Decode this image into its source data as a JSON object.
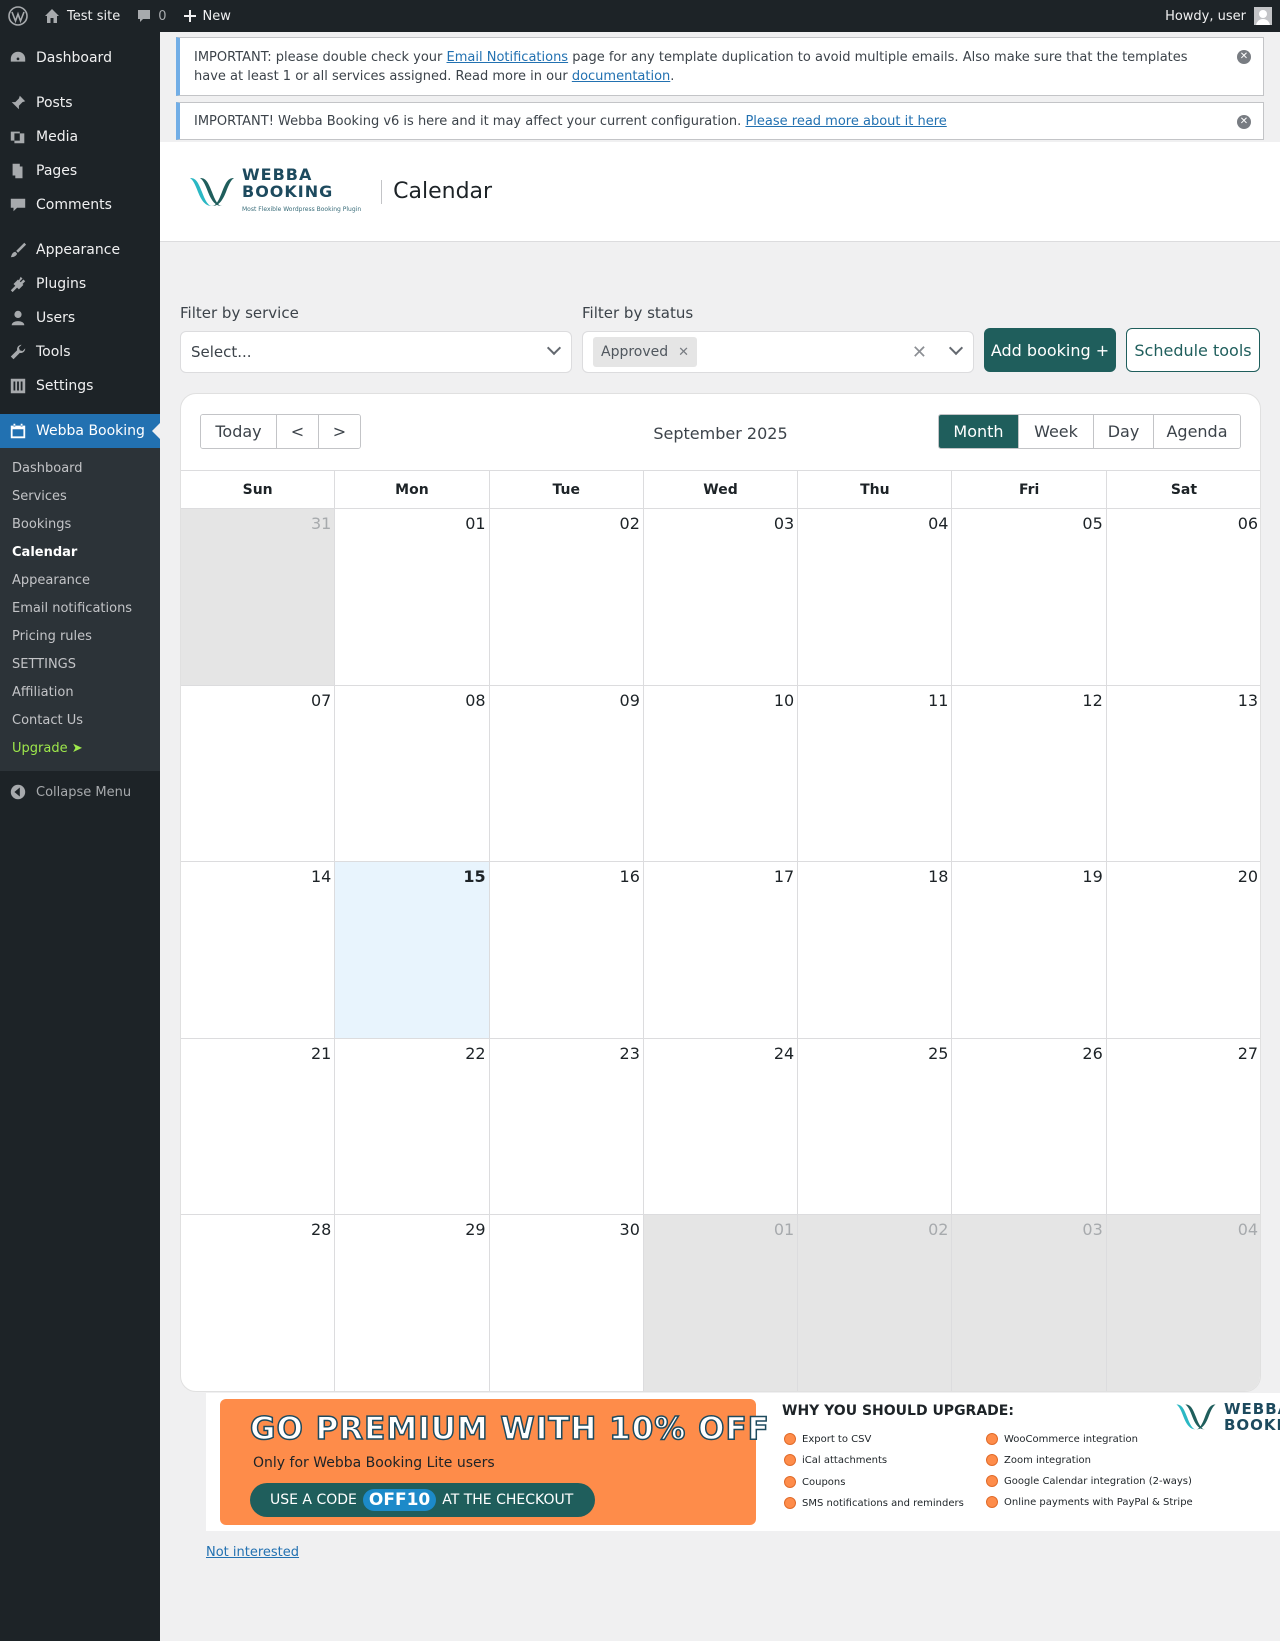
{
  "adminbar": {
    "site_name": "Test site",
    "comments_count": "0",
    "new_label": "New",
    "howdy": "Howdy, user"
  },
  "sidebar": {
    "items": [
      {
        "label": "Dashboard",
        "icon": "dashboard-icon"
      },
      {
        "label": "Posts",
        "icon": "pin-icon"
      },
      {
        "label": "Media",
        "icon": "media-icon"
      },
      {
        "label": "Pages",
        "icon": "pages-icon"
      },
      {
        "label": "Comments",
        "icon": "comment-icon"
      },
      {
        "label": "Appearance",
        "icon": "brush-icon"
      },
      {
        "label": "Plugins",
        "icon": "plug-icon"
      },
      {
        "label": "Users",
        "icon": "user-icon"
      },
      {
        "label": "Tools",
        "icon": "wrench-icon"
      },
      {
        "label": "Settings",
        "icon": "settings-icon"
      },
      {
        "label": "Webba Booking",
        "icon": "calendar-icon"
      }
    ],
    "submenu": [
      "Dashboard",
      "Services",
      "Bookings",
      "Calendar",
      "Appearance",
      "Email notifications",
      "Pricing rules",
      "SETTINGS",
      "Affiliation",
      "Contact Us",
      "Upgrade ➤"
    ],
    "collapse_label": "Collapse Menu"
  },
  "notices": {
    "n1_pre": "IMPORTANT: please double check your ",
    "n1_link": "Email Notifications",
    "n1_mid": " page for any template duplication to avoid multiple emails. Also make sure that the templates have at least 1 or all services assigned. Read more in our ",
    "n1_link2": "documentation",
    "n1_post": ".",
    "n2_pre": "IMPORTANT! Webba Booking v6 is here and it may affect your current configuration. ",
    "n2_link": "Please read more about it here"
  },
  "header": {
    "logo_line1": "WEBBA",
    "logo_line2": "BOOKING",
    "logo_tagline": "Most Flexible Wordpress Booking Plugin",
    "title": "Calendar"
  },
  "filters": {
    "service_label": "Filter by service",
    "service_placeholder": "Select...",
    "status_label": "Filter by status",
    "status_chip": "Approved",
    "add_booking": "Add booking +",
    "schedule_tools": "Schedule tools"
  },
  "calendar": {
    "title": "September 2025",
    "nav": [
      "Today",
      "<",
      ">"
    ],
    "views": [
      "Month",
      "Week",
      "Day",
      "Agenda"
    ],
    "active_view": "Month",
    "weekdays": [
      "Sun",
      "Mon",
      "Tue",
      "Wed",
      "Thu",
      "Fri",
      "Sat"
    ],
    "weeks": [
      [
        "31",
        "01",
        "02",
        "03",
        "04",
        "05",
        "06"
      ],
      [
        "07",
        "08",
        "09",
        "10",
        "11",
        "12",
        "13"
      ],
      [
        "14",
        "15",
        "16",
        "17",
        "18",
        "19",
        "20"
      ],
      [
        "21",
        "22",
        "23",
        "24",
        "25",
        "26",
        "27"
      ],
      [
        "28",
        "29",
        "30",
        "01",
        "02",
        "03",
        "04"
      ]
    ],
    "today": "15"
  },
  "promo": {
    "title": "GO PREMIUM WITH 10% OFF",
    "subtitle": "Only for Webba Booking Lite users",
    "code_pre": "USE A CODE",
    "code": "OFF10",
    "code_post": "AT THE CHECKOUT",
    "why_title": "WHY YOU SHOULD UPGRADE:",
    "features_left": [
      "Export to CSV",
      "iCal attachments",
      "Coupons",
      "SMS notifications and reminders"
    ],
    "features_right": [
      "WooCommerce integration",
      "Zoom integration",
      "Google Calendar integration (2-ways)",
      "Online payments with PayPal & Stripe"
    ],
    "logo_line1": "WEBBA",
    "logo_line2": "BOOKING"
  },
  "not_interested": "Not interested",
  "colors": {
    "accent": "#1f5e5c",
    "wp_blue": "#2271b1",
    "promo_orange": "#fe8c4a"
  }
}
